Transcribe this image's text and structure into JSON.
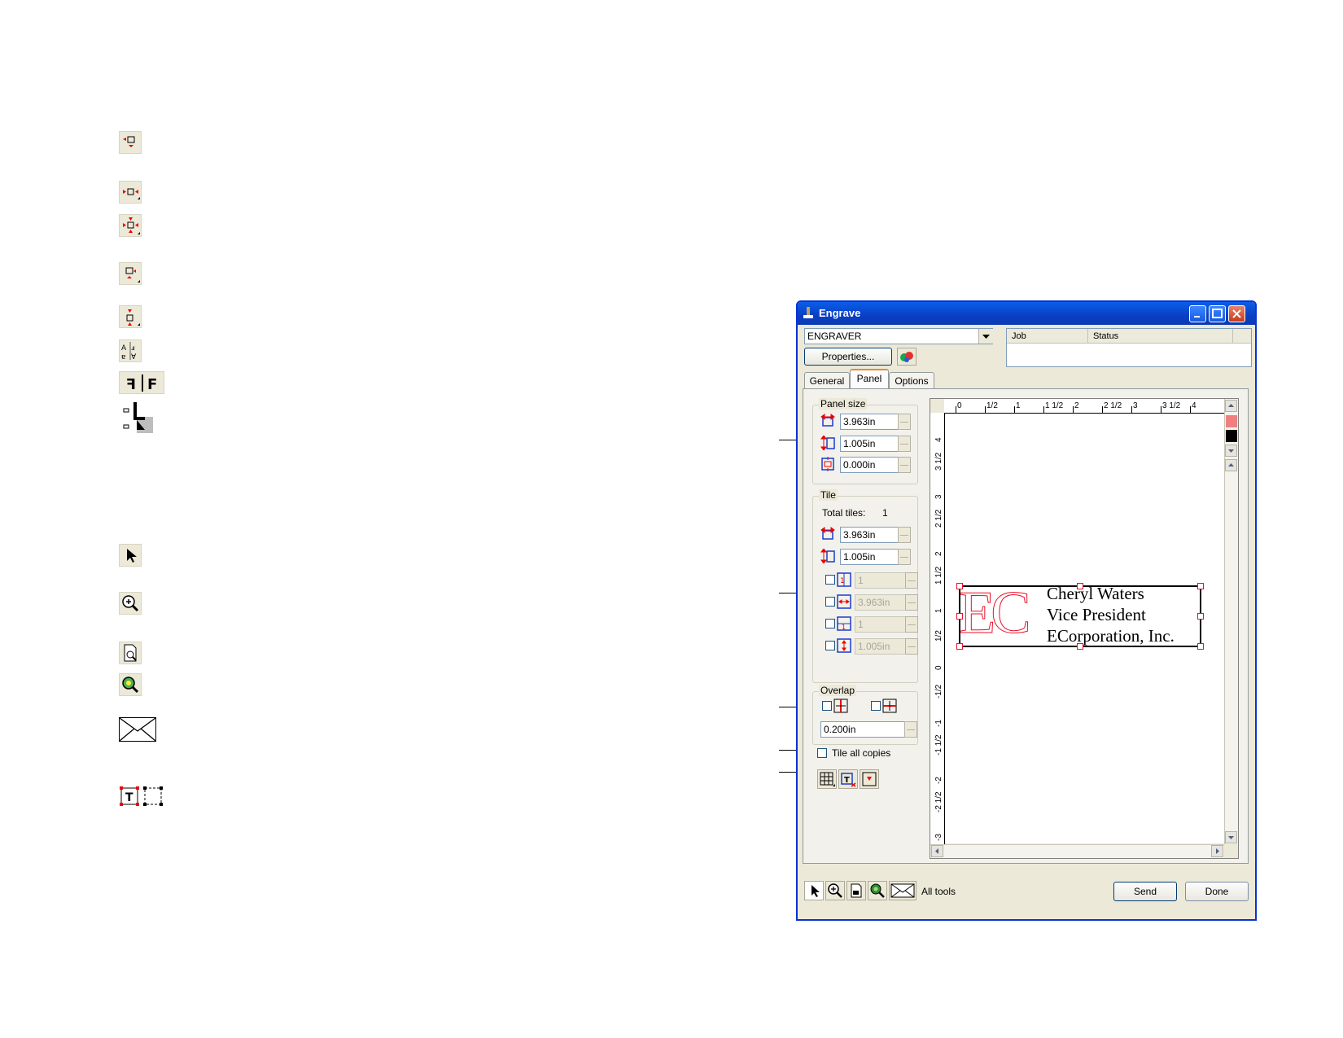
{
  "window": {
    "title": "Engrave",
    "printer": "ENGRAVER",
    "properties_label": "Properties...",
    "job_columns": [
      "Job",
      "Status"
    ],
    "tabs": [
      {
        "label": "General",
        "active": false
      },
      {
        "label": "Panel",
        "active": true
      },
      {
        "label": "Options",
        "active": false
      }
    ]
  },
  "panel_size": {
    "label": "Panel size",
    "width": "3.963in",
    "height": "1.005in",
    "margin": "0.000in"
  },
  "tile": {
    "label": "Tile",
    "total_label": "Total tiles:",
    "total_value": "1",
    "width": "3.963in",
    "height": "1.005in",
    "options": [
      {
        "value": "1",
        "checked": false
      },
      {
        "value": "3.963in",
        "checked": false
      },
      {
        "value": "1",
        "checked": false
      },
      {
        "value": "1.005in",
        "checked": false
      }
    ]
  },
  "overlap": {
    "label": "Overlap",
    "value": "0.200in"
  },
  "tile_all_copies": "Tile all copies",
  "preview": {
    "ruler_top": [
      "0",
      "1/2",
      "1",
      "1 1/2",
      "2",
      "2 1/2",
      "3",
      "3 1/2",
      "4"
    ],
    "ruler_left": [
      "4",
      "3 1/2",
      "3",
      "2 1/2",
      "2",
      "1 1/2",
      "1",
      "1/2",
      "0",
      "-1/2",
      "-1",
      "-1 1/2",
      "-2",
      "-2 1/2",
      "-3"
    ],
    "logo_text": "EC",
    "card_lines": [
      "Cheryl Waters",
      "Vice President",
      "ECorporation, Inc."
    ]
  },
  "colors": {
    "swatch1": "#f08080",
    "swatch2": "#000000",
    "outline_red": "#e8102a",
    "titlebar": "#0a4fd6"
  },
  "toolbar": {
    "all_tools_label": "All tools",
    "send_label": "Send",
    "done_label": "Done"
  },
  "icons_left": [
    "move-center-down-icon",
    "center-horizontal-icon",
    "center-both-icon",
    "center-right-down-icon",
    "center-vertical-icon",
    "rotate-orientation-icon",
    "mirror-icon",
    "panel-position-icon",
    "select-arrow-icon",
    "zoom-in-icon",
    "zoom-page-icon",
    "zoom-fit-icon",
    "envelope-icon",
    "text-frame-icons"
  ]
}
